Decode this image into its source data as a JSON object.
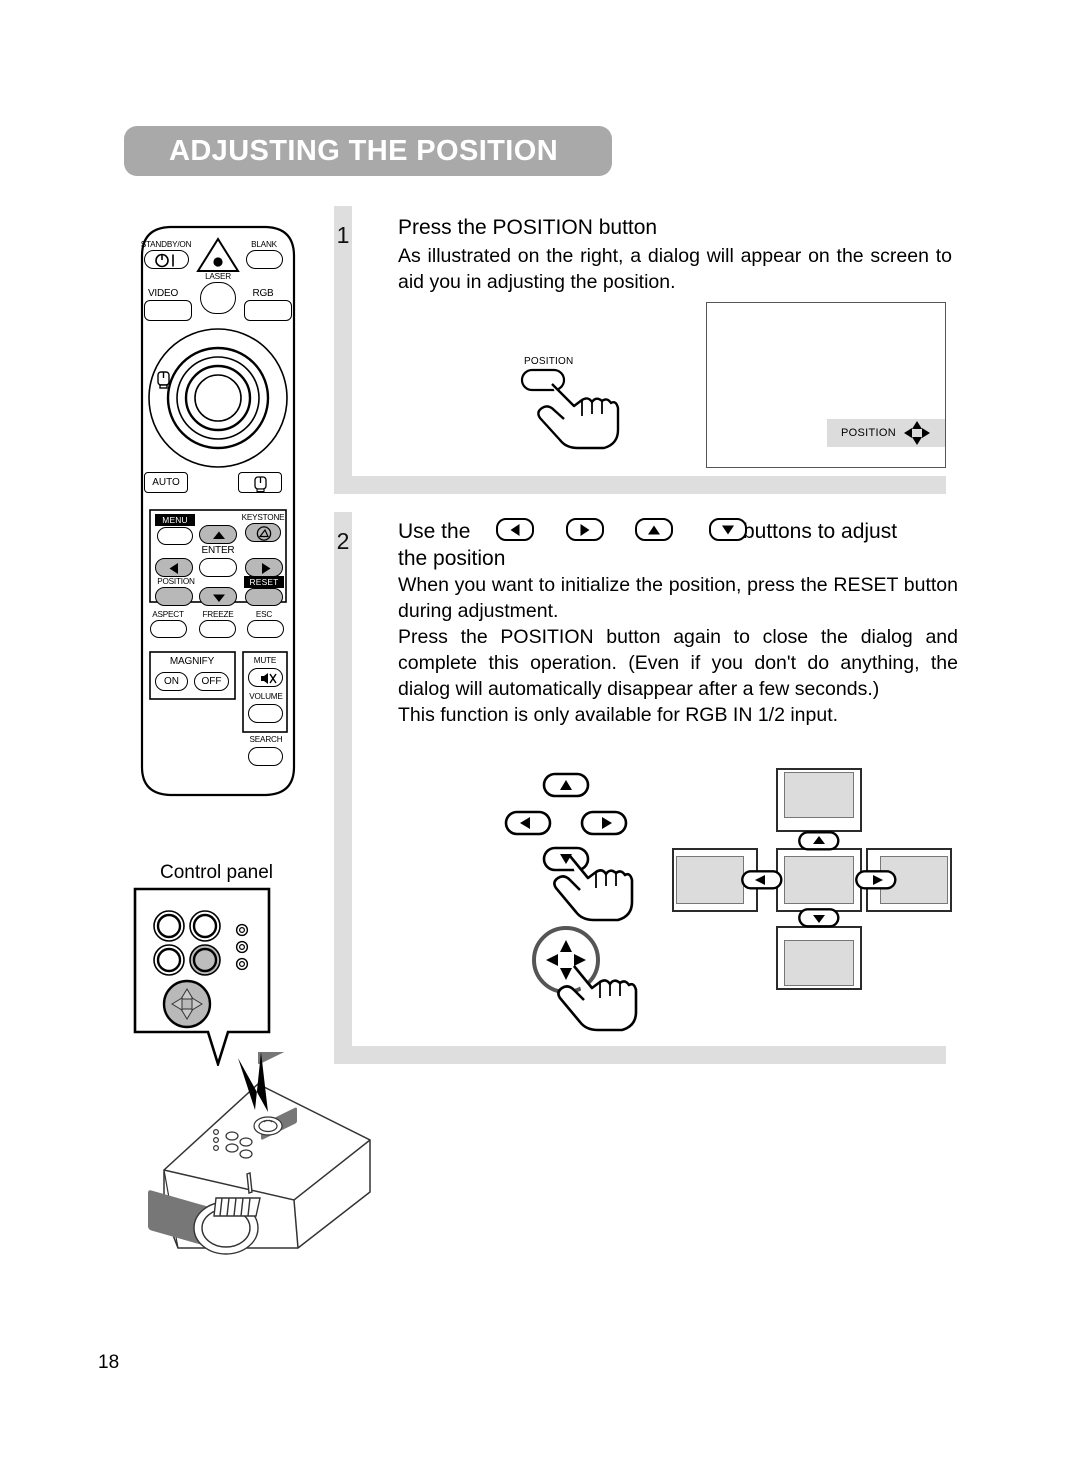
{
  "header": {
    "title": "ADJUSTING THE POSITION"
  },
  "page": {
    "number": "18"
  },
  "steps": [
    {
      "number": "1",
      "heading": "Press the POSITION button",
      "body": "As illustrated on the right, a dialog will appear on the screen to aid you in adjusting the position."
    },
    {
      "number": "2",
      "heading_pre": "Use the",
      "heading_post": "buttons to adjust",
      "heading_line2": "the position",
      "para1": "When you want to initialize the position, press the RESET button during adjustment.",
      "para2": "Press the POSITION button again to close the dialog and complete this operation.  (Even if you don't do anything, the dialog will automatically disappear after a few seconds.)",
      "para3": "This function is only available for RGB IN 1/2 input.",
      "inline_buttons": [
        "left-arrow",
        "right-arrow",
        "up-arrow",
        "down-arrow"
      ]
    }
  ],
  "press_illustration": {
    "button_label": "POSITION"
  },
  "osd": {
    "dialog_label": "POSITION"
  },
  "control_panel": {
    "label": "Control panel"
  },
  "remote": {
    "name": "remote-control",
    "buttons": [
      {
        "name": "standby-on",
        "label": "STANDBY/ON"
      },
      {
        "name": "laser",
        "label": "LASER"
      },
      {
        "name": "blank",
        "label": "BLANK"
      },
      {
        "name": "video",
        "label": "VIDEO"
      },
      {
        "name": "rgb",
        "label": "RGB"
      },
      {
        "name": "auto",
        "label": "AUTO"
      },
      {
        "name": "menu",
        "label": "MENU"
      },
      {
        "name": "keystone",
        "label": "KEYSTONE"
      },
      {
        "name": "enter",
        "label": "ENTER"
      },
      {
        "name": "position",
        "label": "POSITION"
      },
      {
        "name": "reset",
        "label": "RESET"
      },
      {
        "name": "aspect",
        "label": "ASPECT"
      },
      {
        "name": "freeze",
        "label": "FREEZE"
      },
      {
        "name": "esc",
        "label": "ESC"
      },
      {
        "name": "magnify",
        "label": "MAGNIFY"
      },
      {
        "name": "magnify-on",
        "label": "ON"
      },
      {
        "name": "magnify-off",
        "label": "OFF"
      },
      {
        "name": "mute",
        "label": "MUTE"
      },
      {
        "name": "volume",
        "label": "VOLUME"
      },
      {
        "name": "search",
        "label": "SEARCH"
      }
    ]
  },
  "colors": {
    "header_bar": "#a9a9a9",
    "panel_gray": "#dedede",
    "osd_gray": "#dcdcdc",
    "button_gray": "#b8b8b8"
  }
}
